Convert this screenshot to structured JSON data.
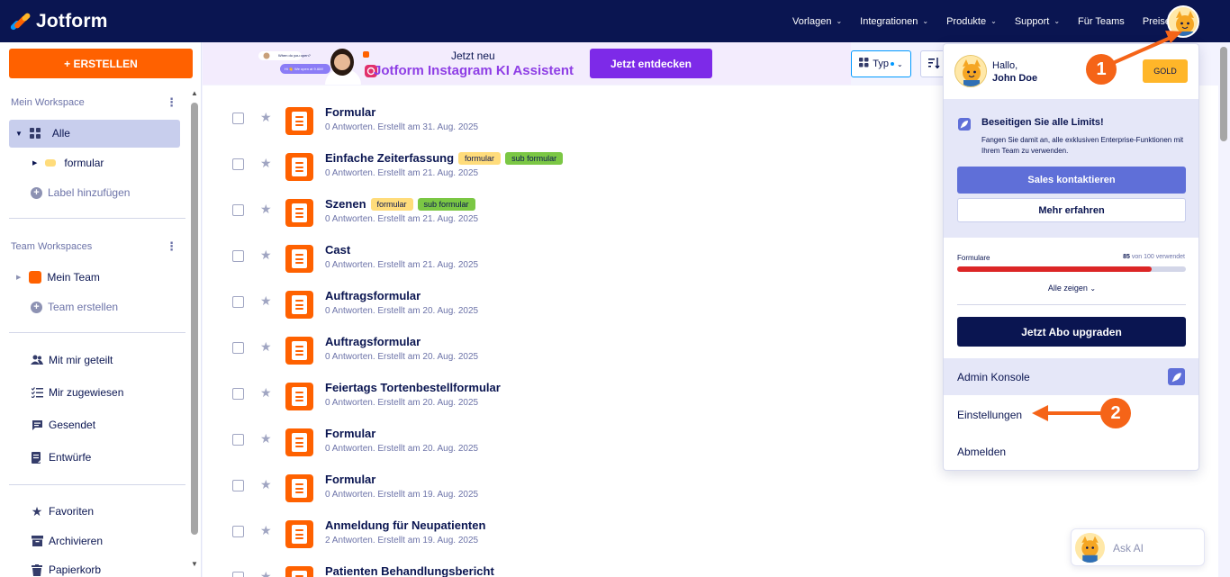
{
  "brand": {
    "name": "Jotform"
  },
  "nav": {
    "links": [
      "Vorlagen",
      "Integrationen",
      "Produkte",
      "Support",
      "Für Teams",
      "Preise"
    ]
  },
  "sidebar": {
    "create_label": "+ ERSTELLEN",
    "workspace_heading": "Mein Workspace",
    "all_label": "Alle",
    "folder_label": "formular",
    "add_label": "Label hinzufügen",
    "team_heading": "Team Workspaces",
    "my_team": "Mein Team",
    "create_team": "Team erstellen",
    "shared": "Mit mir geteilt",
    "assigned": "Mir zugewiesen",
    "sent": "Gesendet",
    "drafts": "Entwürfe",
    "favorites": "Favoriten",
    "archive": "Archivieren",
    "trash": "Papierkorb"
  },
  "banner": {
    "new_label": "Jetzt neu",
    "title": "Jotform Instagram KI Assistent",
    "cta": "Jetzt entdecken",
    "bubble1": "When do you open?",
    "bubble2": "Hi 👋 We open at 9 AM!"
  },
  "toolbar": {
    "type_label": "Typ"
  },
  "forms": [
    {
      "title": "Formular",
      "sub": "0 Antworten. Erstellt am 31. Aug. 2025",
      "tags": []
    },
    {
      "title": "Einfache Zeiterfassung",
      "sub": "0 Antworten. Erstellt am 21. Aug. 2025",
      "tags": [
        "formular",
        "sub formular"
      ]
    },
    {
      "title": "Szenen",
      "sub": "0 Antworten. Erstellt am 21. Aug. 2025",
      "tags": [
        "formular",
        "sub formular"
      ]
    },
    {
      "title": "Cast",
      "sub": "0 Antworten. Erstellt am 21. Aug. 2025",
      "tags": []
    },
    {
      "title": "Auftragsformular",
      "sub": "0 Antworten. Erstellt am 20. Aug. 2025",
      "tags": []
    },
    {
      "title": "Auftragsformular",
      "sub": "0 Antworten. Erstellt am 20. Aug. 2025",
      "tags": []
    },
    {
      "title": "Feiertags Tortenbestellformular",
      "sub": "0 Antworten. Erstellt am 20. Aug. 2025",
      "tags": []
    },
    {
      "title": "Formular",
      "sub": "0 Antworten. Erstellt am 20. Aug. 2025",
      "tags": []
    },
    {
      "title": "Formular",
      "sub": "0 Antworten. Erstellt am 19. Aug. 2025",
      "tags": []
    },
    {
      "title": "Anmeldung für Neupatienten",
      "sub": "2 Antworten. Erstellt am 19. Aug. 2025",
      "tags": []
    },
    {
      "title": "Patienten Behandlungsbericht",
      "sub": "",
      "tags": []
    }
  ],
  "account_menu": {
    "greeting": "Hallo,",
    "user_name": "John Doe",
    "plan_badge": "GOLD",
    "promo_title": "Beseitigen Sie alle Limits!",
    "promo_text": "Fangen Sie damit an, alle exklusiven Enterprise-Funktionen mit Ihrem Team zu verwenden.",
    "sales_button": "Sales kontaktieren",
    "more_button": "Mehr erfahren",
    "usage_label": "Formulare",
    "usage_used": "85",
    "usage_rest": "von 100 verwendet",
    "usage_fraction": 0.85,
    "show_all": "Alle zeigen",
    "upgrade_button": "Jetzt Abo upgraden",
    "admin_console": "Admin Konsole",
    "settings": "Einstellungen",
    "logout": "Abmelden"
  },
  "annotations": {
    "step1": "1",
    "step2": "2",
    "color": "#f56418"
  },
  "ask_ai": {
    "label": "Ask AI"
  },
  "colors": {
    "navy": "#0a1551",
    "orange": "#ff6100",
    "purple": "#7d2ae8",
    "accent_blue": "#5f6fd8",
    "gold": "#ffb629",
    "usage_bar": "#dc2626"
  }
}
